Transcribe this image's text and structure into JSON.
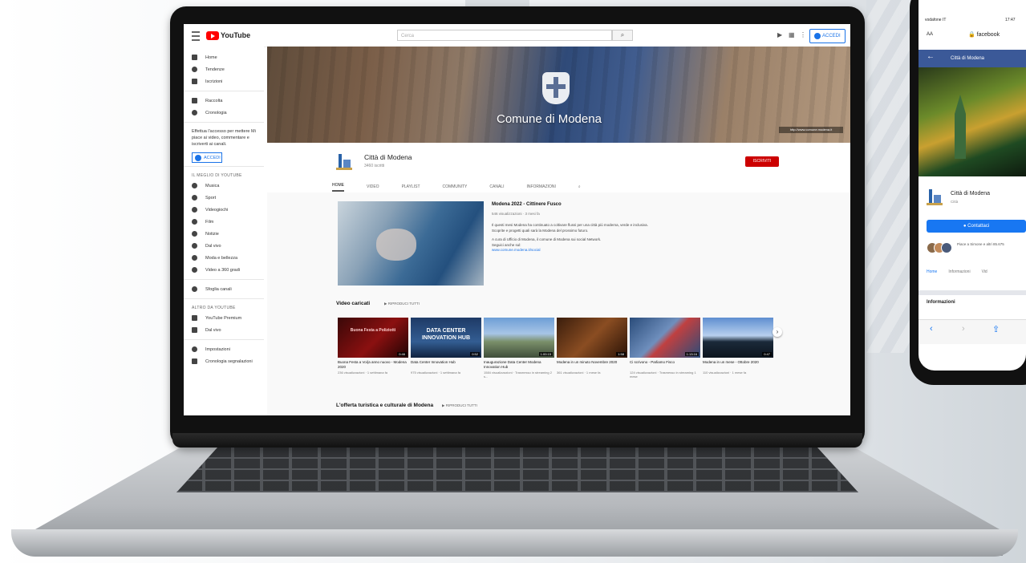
{
  "youtube": {
    "logo_text": "YouTube",
    "search_placeholder": "Cerca",
    "sign_in_label": "ACCEDI",
    "sidebar": {
      "main_items": [
        "Home",
        "Tendenze",
        "Iscrizioni"
      ],
      "library_items": [
        "Raccolta",
        "Cronologia"
      ],
      "sign_in_prompt": "Effettua l'accesso per mettere Mi piace ai video, commentare e iscriverti ai canali.",
      "sign_in_label": "ACCEDI",
      "best_of_heading": "IL MEGLIO DI YOUTUBE",
      "best_of_items": [
        "Musica",
        "Sport",
        "Videogiochi",
        "Film",
        "Notizie",
        "Dal vivo",
        "Moda e bellezza",
        "Video a 360 gradi"
      ],
      "browse_channels": "Sfoglia canali",
      "more_heading": "ALTRO DA YOUTUBE",
      "more_items": [
        "YouTube Premium",
        "Dal vivo"
      ],
      "footer_items": [
        "Impostazioni",
        "Cronologia segnalazioni"
      ]
    },
    "banner": {
      "title": "Comune di Modena",
      "link": "http://www.comune.modena.it"
    },
    "channel": {
      "name": "Città di Modena",
      "subscribers": "3460 iscritti",
      "subscribe_label": "ISCRIVITI"
    },
    "tabs": [
      "HOME",
      "VIDEO",
      "PLAYLIST",
      "COMMUNITY",
      "CANALI",
      "INFORMAZIONI"
    ],
    "featured": {
      "title": "Modena 2022 - Cittinere Fusco",
      "meta": "546 visualizzazioni · 3 mesi fa",
      "desc1": "Il questi mesi Modena ha continuato a coltivare flussi per una città più moderna, verde e inclusiva. Scoprite e progetti quali sarà la Modena del prossimo futuro.",
      "desc2": "A cura di Ufficio di Modena, il comune di Modena sui social Network.",
      "desc3": "Seguici anche sul:",
      "link": "www.comune.modena.it/social"
    },
    "uploads": {
      "title": "Video caricati",
      "play_all": "RIPRODUCI TUTTI",
      "videos": [
        {
          "thumb_text": "Buona Festa a Poliziotti",
          "duration": "0:46",
          "title": "Buona Festa a Voi(a anno nuovo - Modena 2020",
          "meta": "236 visualizzazioni · 1 settimana fa"
        },
        {
          "thumb_text": "DATA CENTER INNOVATION HUB",
          "duration": "0:52",
          "title": "Data Center Innovation Hub",
          "meta": "975 visualizzazioni · 1 settimana fa"
        },
        {
          "thumb_text": "",
          "duration": "1:00:15",
          "title": "Inaugurazione Data Center Modena Innovation Hub",
          "meta": "1584 visualizzazioni · Trasmesso in streaming 2 s..."
        },
        {
          "thumb_text": "",
          "duration": "1:58",
          "title": "Modena in un minuto Novembre 2020",
          "meta": "361 visualizzazioni · 1 mese fa"
        },
        {
          "thumb_text": "",
          "duration": "1:13:16",
          "title": "Ci scrivono - Parliamo Fisco",
          "meta": "124 visualizzazioni · Trasmesso in streaming 1 mese"
        },
        {
          "thumb_text": "",
          "duration": "0:47",
          "title": "Modena in un mese - Ottobre 2020",
          "meta": "110 visualizzazioni · 1 mese fa"
        }
      ]
    },
    "next_section": {
      "title": "L'offerta turistica e culturale di Modena",
      "play_all": "RIPRODUCI TUTTI"
    }
  },
  "phone": {
    "status_left": "vodafone IT",
    "time": "17:47",
    "url_aa": "AA",
    "url": "facebook",
    "page_title": "Città di Modena",
    "page_name": "Città di Modena",
    "page_category": "Città",
    "contact_label": "Contattaci",
    "likes_text": "Piace a Simone e altri 85.675",
    "tabs": [
      "Home",
      "Informazioni",
      "Vid"
    ],
    "info_heading": "Informazioni"
  },
  "colors": {
    "youtube_red": "#ff0000",
    "subscribe_red": "#cc0000",
    "link_blue": "#1a73e8",
    "facebook_blue": "#3b5998"
  }
}
